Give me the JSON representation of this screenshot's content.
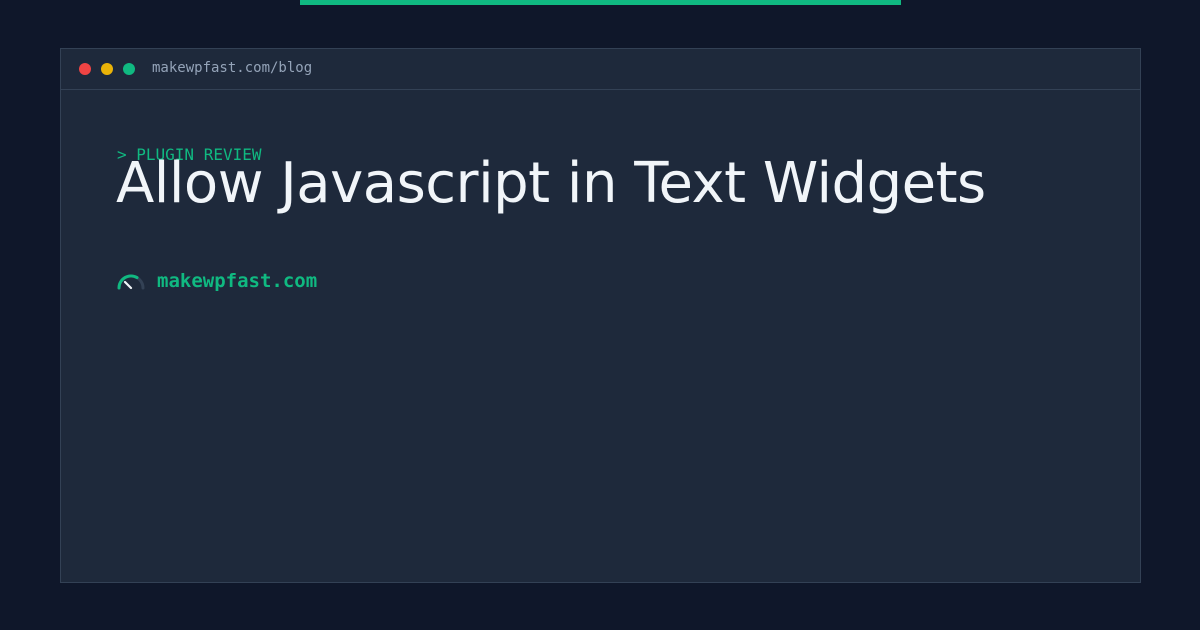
{
  "window": {
    "url": "makewpfast.com/blog"
  },
  "hero": {
    "kicker": "> PLUGIN REVIEW",
    "title": "Allow Javascript in Text Widgets"
  },
  "brand": {
    "icon": "speedometer-icon",
    "name": "makewpfast.com"
  },
  "colors": {
    "background": "#0f172a",
    "panel": "#1e293b",
    "accent": "#10b981",
    "title_text": "#f1f5f9",
    "muted_text": "#94a3b8",
    "dot_red": "#ef4444",
    "dot_yellow": "#eab308",
    "dot_green": "#10b981"
  }
}
